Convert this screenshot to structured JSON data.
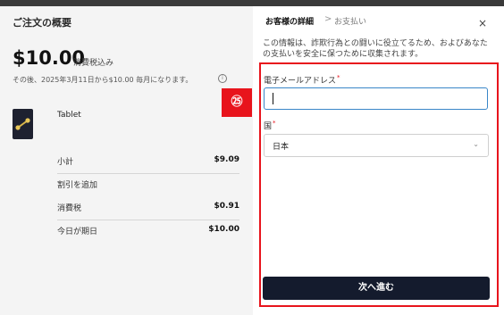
{
  "summary": {
    "title": "ご注文の概要",
    "price": "$10.00",
    "price_note": "消費税込み",
    "renewal_text": "その後、2025年3月11日から$10.00 毎月になります。",
    "info_icon": "i",
    "product_name": "Tablet",
    "subtotal_label": "小計",
    "subtotal_value": "$9.09",
    "discount_label": "割引を追加",
    "tax_label": "消費税",
    "tax_value": "$0.91",
    "due_today_label": "今日が期日",
    "due_today_value": "$10.00"
  },
  "badge": "㉕",
  "checkout": {
    "breadcrumb_step1": "お客様の詳細",
    "breadcrumb_sep": ">",
    "breadcrumb_step2": "お支払い",
    "close_icon": "×",
    "intro": "この情報は、詐欺行為との闘いに役立てるため、およびあなたの支払いを安全に保つために収集されます。",
    "email_label": "電子メールアドレス",
    "email_value": "",
    "required_mark": "*",
    "country_label": "国",
    "country_value": "日本",
    "chevron_icon": "⌄",
    "next_button": "次へ進む"
  },
  "colors": {
    "accent_red": "#e8141c",
    "button_dark": "#141b2d",
    "input_focus": "#3a86c8"
  }
}
